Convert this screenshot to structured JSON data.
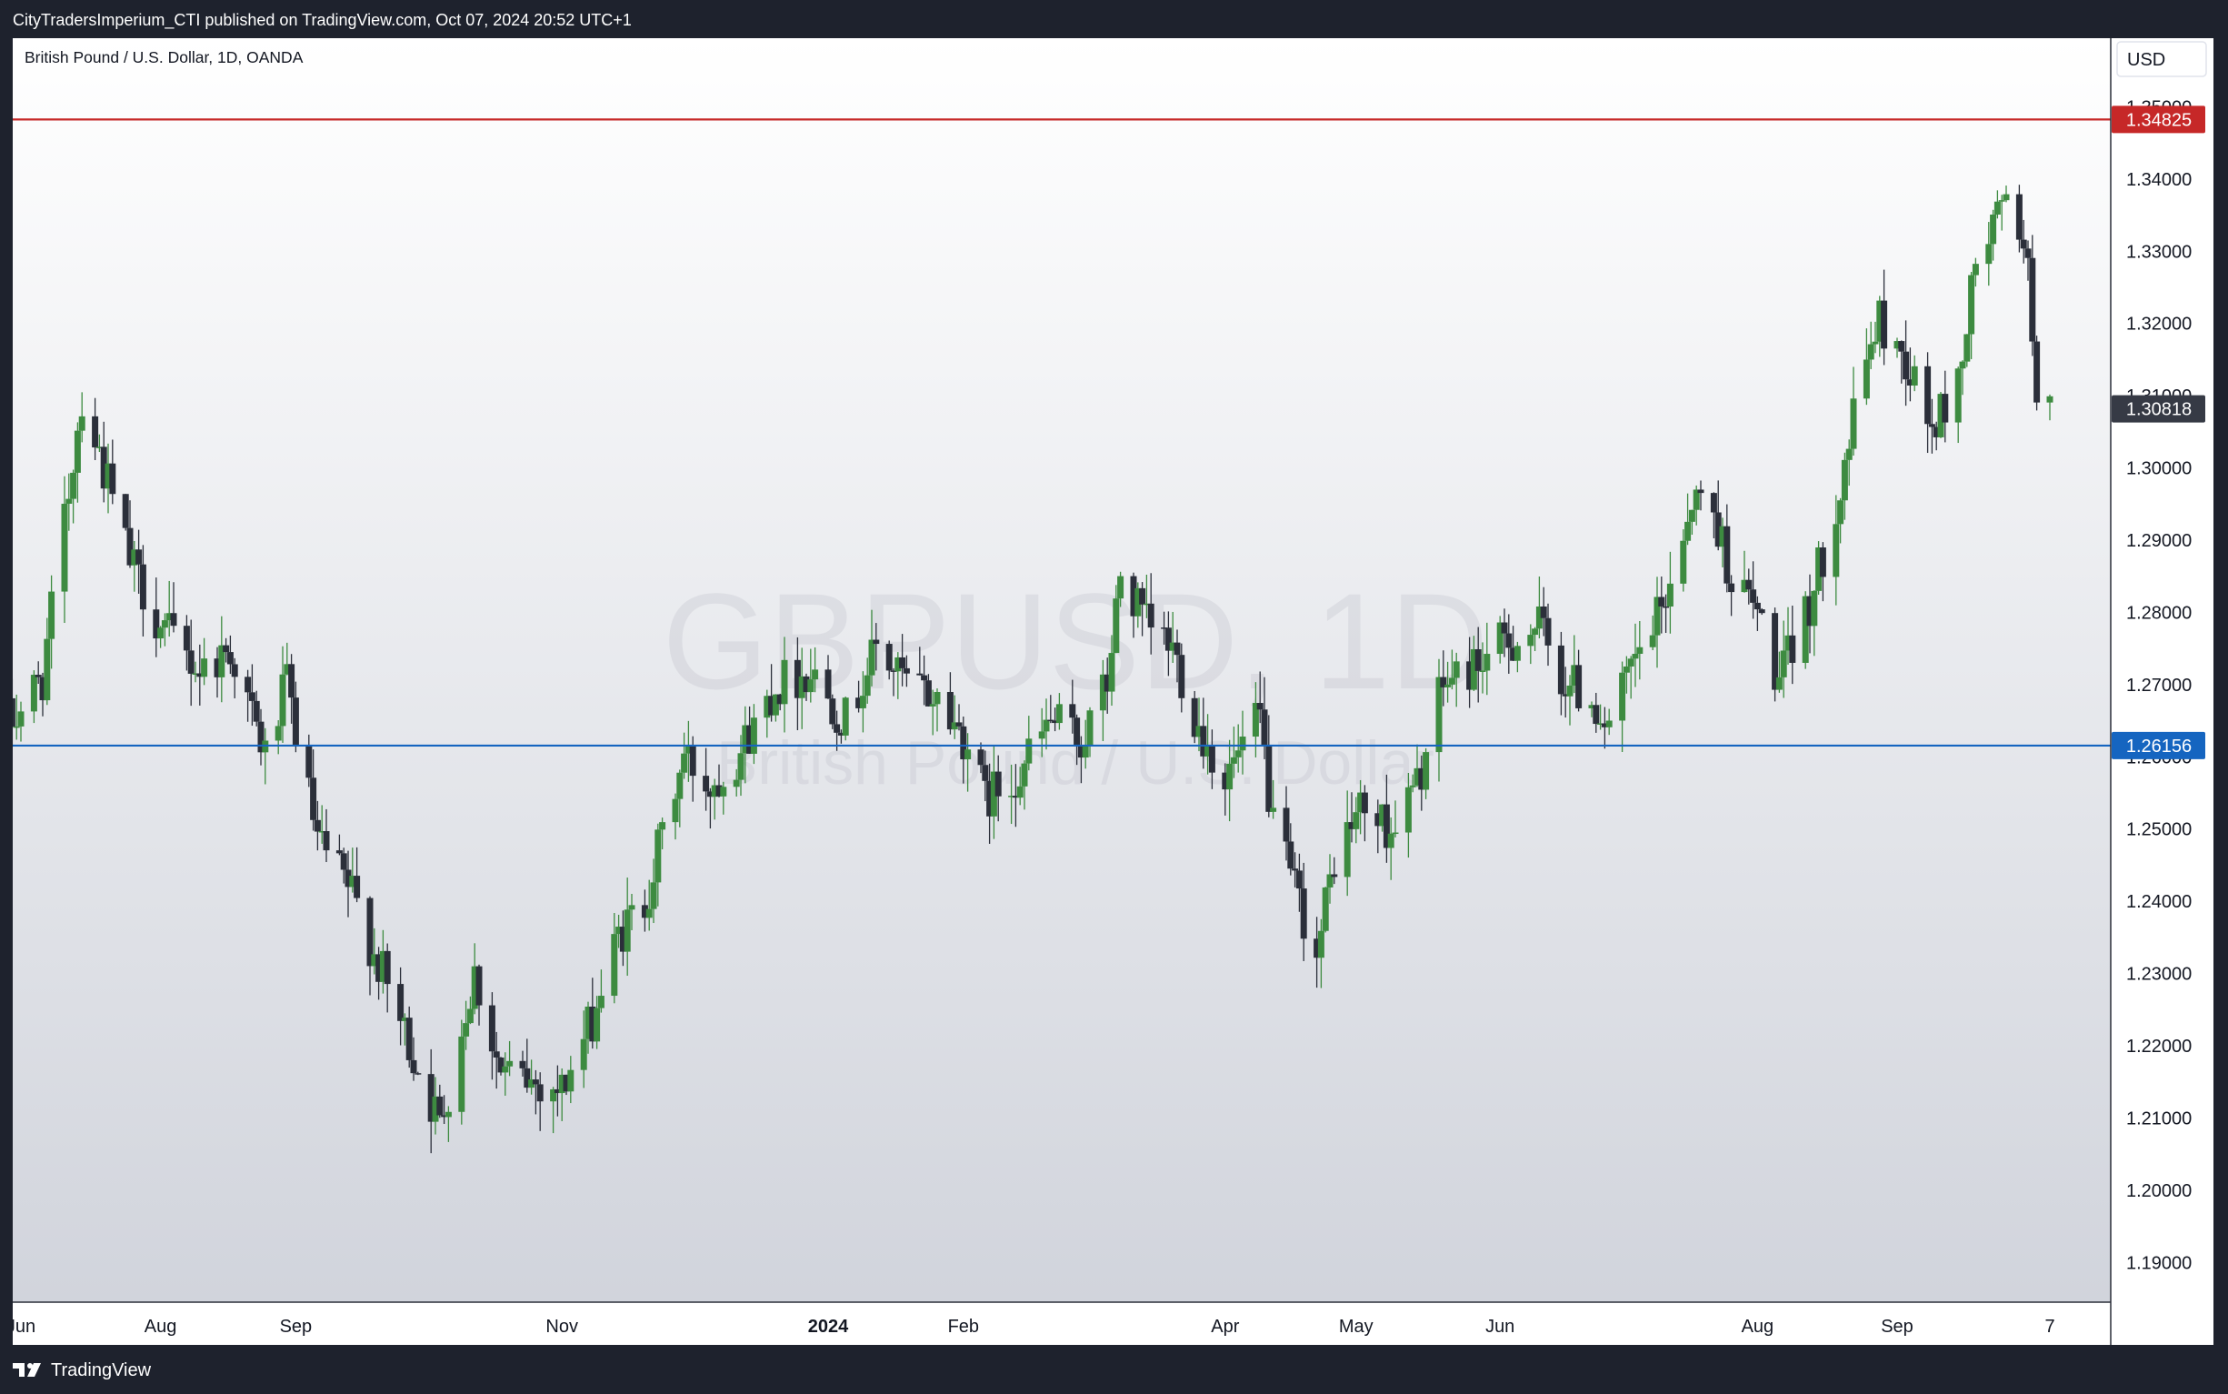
{
  "header": {
    "publisher_line": "CityTradersImperium_CTI published on TradingView.com, Oct 07, 2024 20:52 UTC+1"
  },
  "chart_header": {
    "symbol_line": "British Pound / U.S. Dollar, 1D, OANDA",
    "currency_button": "USD"
  },
  "watermark": {
    "symbol": "GBPUSD, 1D",
    "description": "British Pound / U.S. Dollar"
  },
  "footer": {
    "brand": "TradingView"
  },
  "colors": {
    "up": "#3d8b40",
    "down": "#2b2f3a",
    "resistance": "#c62828",
    "support": "#1565c0",
    "last_price_badge": "#363a45",
    "background_top": "#ffffff",
    "background_bottom": "#d1d4dc"
  },
  "chart_data": {
    "type": "candlestick",
    "title": "British Pound / U.S. Dollar, 1D, OANDA",
    "ylim": [
      1.1845,
      1.3595
    ],
    "y_ticks": [
      "1.19000",
      "1.20000",
      "1.21000",
      "1.22000",
      "1.23000",
      "1.24000",
      "1.25000",
      "1.26000",
      "1.27000",
      "1.28000",
      "1.29000",
      "1.30000",
      "1.31000",
      "1.32000",
      "1.33000",
      "1.34000",
      "1.35000"
    ],
    "x_ticks": [
      {
        "label": "Jun",
        "date": "2023-06-30",
        "bold": false
      },
      {
        "label": "Aug",
        "date": "2023-08-01",
        "bold": false
      },
      {
        "label": "Sep",
        "date": "2023-09-01",
        "bold": false
      },
      {
        "label": "Nov",
        "date": "2023-11-01",
        "bold": false
      },
      {
        "label": "2024",
        "date": "2024-01-01",
        "bold": true
      },
      {
        "label": "Feb",
        "date": "2024-02-01",
        "bold": false
      },
      {
        "label": "Apr",
        "date": "2024-04-01",
        "bold": false
      },
      {
        "label": "May",
        "date": "2024-05-01",
        "bold": false
      },
      {
        "label": "Jun",
        "date": "2024-06-03",
        "bold": false
      },
      {
        "label": "Aug",
        "date": "2024-08-01",
        "bold": false
      },
      {
        "label": "Sep",
        "date": "2024-09-02",
        "bold": false
      },
      {
        "label": "7",
        "date": "2024-10-07",
        "bold": false
      }
    ],
    "horizontal_lines": [
      {
        "name": "resistance",
        "price": 1.34825,
        "label": "1.34825",
        "color": "#c62828"
      },
      {
        "name": "support",
        "price": 1.26156,
        "label": "1.26156",
        "color": "#1565c0"
      }
    ],
    "last_price": {
      "price": 1.30818,
      "label": "1.30818"
    },
    "close_path": [
      [
        "2023-06-28",
        1.265
      ],
      [
        "2023-07-05",
        1.271
      ],
      [
        "2023-07-14",
        1.31
      ],
      [
        "2023-07-18",
        1.302
      ],
      [
        "2023-07-25",
        1.287
      ],
      [
        "2023-08-01",
        1.278
      ],
      [
        "2023-08-10",
        1.272
      ],
      [
        "2023-08-17",
        1.275
      ],
      [
        "2023-08-25",
        1.26
      ],
      [
        "2023-08-30",
        1.27
      ],
      [
        "2023-09-06",
        1.248
      ],
      [
        "2023-09-14",
        1.241
      ],
      [
        "2023-09-22",
        1.228
      ],
      [
        "2023-09-29",
        1.217
      ],
      [
        "2023-10-04",
        1.209
      ],
      [
        "2023-10-12",
        1.23
      ],
      [
        "2023-10-18",
        1.216
      ],
      [
        "2023-10-25",
        1.215
      ],
      [
        "2023-11-01",
        1.214
      ],
      [
        "2023-11-07",
        1.222
      ],
      [
        "2023-11-14",
        1.235
      ],
      [
        "2023-11-20",
        1.24
      ],
      [
        "2023-11-24",
        1.249
      ],
      [
        "2023-11-29",
        1.26
      ],
      [
        "2023-12-05",
        1.256
      ],
      [
        "2023-12-12",
        1.261
      ],
      [
        "2023-12-20",
        1.27
      ],
      [
        "2023-12-28",
        1.272
      ],
      [
        "2024-01-05",
        1.265
      ],
      [
        "2024-01-12",
        1.275
      ],
      [
        "2024-01-19",
        1.27
      ],
      [
        "2024-01-26",
        1.268
      ],
      [
        "2024-02-02",
        1.262
      ],
      [
        "2024-02-06",
        1.254
      ],
      [
        "2024-02-14",
        1.258
      ],
      [
        "2024-02-21",
        1.265
      ],
      [
        "2024-02-28",
        1.262
      ],
      [
        "2024-03-05",
        1.27
      ],
      [
        "2024-03-08",
        1.285
      ],
      [
        "2024-03-14",
        1.278
      ],
      [
        "2024-03-20",
        1.275
      ],
      [
        "2024-03-26",
        1.264
      ],
      [
        "2024-04-01",
        1.257
      ],
      [
        "2024-04-09",
        1.265
      ],
      [
        "2024-04-12",
        1.25
      ],
      [
        "2024-04-19",
        1.238
      ],
      [
        "2024-04-22",
        1.232
      ],
      [
        "2024-04-26",
        1.246
      ],
      [
        "2024-05-02",
        1.253
      ],
      [
        "2024-05-09",
        1.25
      ],
      [
        "2024-05-15",
        1.256
      ],
      [
        "2024-05-21",
        1.27
      ],
      [
        "2024-05-29",
        1.273
      ],
      [
        "2024-06-05",
        1.276
      ],
      [
        "2024-06-12",
        1.278
      ],
      [
        "2024-06-17",
        1.271
      ],
      [
        "2024-06-24",
        1.268
      ],
      [
        "2024-06-28",
        1.264
      ],
      [
        "2024-07-04",
        1.273
      ],
      [
        "2024-07-10",
        1.28
      ],
      [
        "2024-07-17",
        1.296
      ],
      [
        "2024-07-22",
        1.294
      ],
      [
        "2024-07-26",
        1.285
      ],
      [
        "2024-08-01",
        1.28
      ],
      [
        "2024-08-06",
        1.27
      ],
      [
        "2024-08-09",
        1.275
      ],
      [
        "2024-08-14",
        1.283
      ],
      [
        "2024-08-20",
        1.298
      ],
      [
        "2024-08-27",
        1.318
      ],
      [
        "2024-08-29",
        1.32
      ],
      [
        "2024-09-04",
        1.315
      ],
      [
        "2024-09-10",
        1.305
      ],
      [
        "2024-09-16",
        1.312
      ],
      [
        "2024-09-20",
        1.328
      ],
      [
        "2024-09-26",
        1.336
      ],
      [
        "2024-10-01",
        1.333
      ],
      [
        "2024-10-04",
        1.312
      ],
      [
        "2024-10-07",
        1.3082
      ]
    ]
  }
}
